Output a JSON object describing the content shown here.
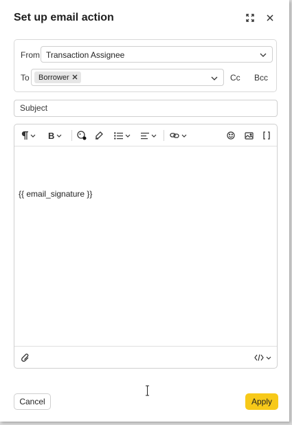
{
  "dialog": {
    "title": "Set up email action"
  },
  "header": {
    "expand_icon": "expand-icon",
    "close_icon": "close-icon"
  },
  "from": {
    "label": "From",
    "value": "Transaction Assignee"
  },
  "to": {
    "label": "To",
    "chips": [
      "Borrower"
    ],
    "cc_label": "Cc",
    "bcc_label": "Bcc"
  },
  "subject": {
    "placeholder": "Subject"
  },
  "toolbar": {
    "icons": [
      "paragraph-icon",
      "bold-icon",
      "text-color-icon",
      "highlight-icon",
      "list-icon",
      "align-icon",
      "link-icon",
      "emoji-icon",
      "image-icon",
      "brackets-icon"
    ]
  },
  "editor": {
    "content": "{{ email_signature }}"
  },
  "footer": {
    "attach_icon": "paperclip-icon",
    "code_icon": "code-icon"
  },
  "actions": {
    "cancel_label": "Cancel",
    "apply_label": "Apply"
  },
  "colors": {
    "accent": "#f7c919",
    "border": "#cfcfcf"
  }
}
